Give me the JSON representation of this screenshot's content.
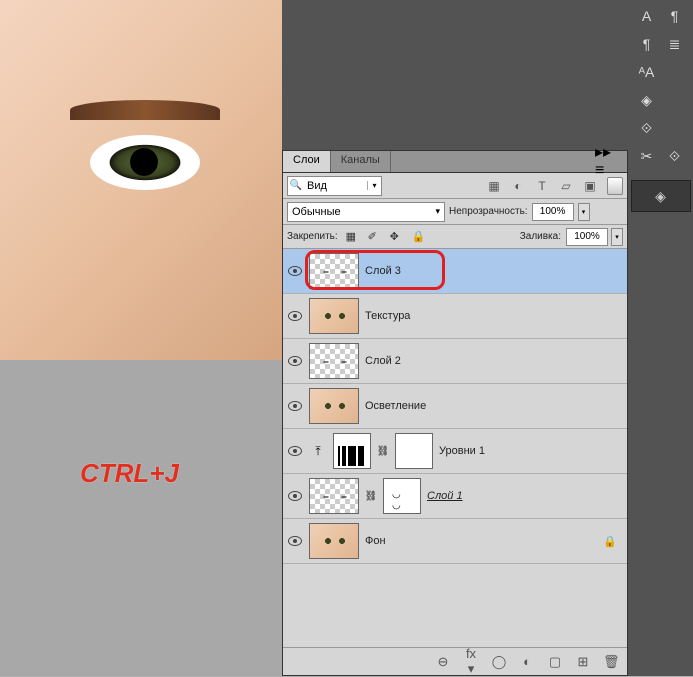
{
  "canvas": {
    "shortcut_text": "CTRL+J"
  },
  "panel": {
    "tabs": {
      "layers": "Слои",
      "channels": "Каналы"
    },
    "menu_glyph": "▸▸ ≡",
    "filter": {
      "search_icon": "🔍",
      "kind_label": "Вид",
      "arrow": "▾"
    },
    "filter_icons": {
      "img": "▦",
      "adj": "◐",
      "type": "T",
      "shape": "▱",
      "smart": "▣"
    },
    "blend_mode": "Обычные",
    "opacity_label": "Непрозрачность:",
    "opacity_value": "100%",
    "lock_label": "Закрепить:",
    "lock_icons": {
      "trans": "▦",
      "brush": "✐",
      "move": "✥",
      "all": "🔒"
    },
    "fill_label": "Заливка:",
    "fill_value": "100%"
  },
  "layers": [
    {
      "name": "Слой 3",
      "thumb": "trans-eyes",
      "selected": true
    },
    {
      "name": "Текстура",
      "thumb": "face"
    },
    {
      "name": "Слой 2",
      "thumb": "trans-eyes"
    },
    {
      "name": "Осветление",
      "thumb": "face"
    },
    {
      "name": "Уровни 1",
      "kind": "adjustment",
      "adj_icon": "⤒",
      "hist": true,
      "mask": "white"
    },
    {
      "name": "Слой 1",
      "thumb": "trans-eyes",
      "mask": "mask-eyes",
      "italic": true
    },
    {
      "name": "Фон",
      "thumb": "face",
      "locked": true
    }
  ],
  "bottom": {
    "link": "⊖",
    "fx": "fx ▾",
    "mask": "◯",
    "adj": "◐",
    "group": "▢",
    "new": "⊞",
    "trash": "🗑"
  },
  "tools": {
    "r1": [
      "A",
      "¶"
    ],
    "r2": [
      "¶",
      "≣"
    ],
    "r3": [
      "ᴬA",
      " "
    ],
    "r4": [
      "◈",
      " "
    ],
    "r5": [
      "⟐",
      " "
    ],
    "r6": [
      "✂",
      "⟐"
    ],
    "layers_btn": "◈"
  }
}
